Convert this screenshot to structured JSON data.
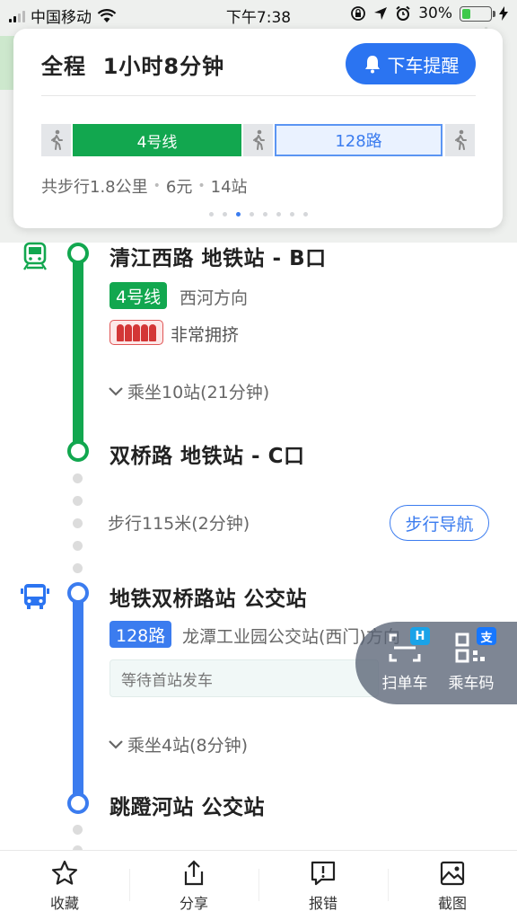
{
  "status_bar": {
    "carrier": "中国移动",
    "time": "下午7:38",
    "battery": "30%",
    "battery_level": 0.3
  },
  "summary_card": {
    "title": "全程  1小时8分钟",
    "remind_button": "下车提醒",
    "segments": {
      "subway": "4号线",
      "bus": "128路"
    },
    "summary_walk": "共步行1.8公里",
    "summary_fare": "6元",
    "summary_stops": "14站",
    "page_count": 8,
    "active_page": 3
  },
  "subway_leg": {
    "start_stop": "清江西路 地铁站 - B口",
    "line_badge": "4号线",
    "direction": "西河方向",
    "crowd": "非常拥挤",
    "ride_info": "乘坐10站(21分钟)",
    "end_stop": "双桥路 地铁站 - C口"
  },
  "walk_leg": {
    "info": "步行115米(2分钟)",
    "nav_button": "步行导航"
  },
  "bus_leg": {
    "start_stop": "地铁双桥路站 公交站",
    "line_badge": "128路",
    "direction": "龙潭工业园公交站(西门)方向",
    "wait_text": "等待首站发车",
    "ride_info": "乘坐4站(8分钟)",
    "end_stop": "跳蹬河站 公交站"
  },
  "float_panel": {
    "scan_bike": "扫单车",
    "scan_bike_badge": "H",
    "ride_code": "乘车码",
    "ride_code_badge": "支"
  },
  "toolbar": {
    "favorite": "收藏",
    "share": "分享",
    "report": "报错",
    "screenshot": "截图"
  },
  "colors": {
    "subway_green": "#12a74f",
    "bus_blue": "#3b7cef",
    "accent_blue": "#2b74f1"
  }
}
